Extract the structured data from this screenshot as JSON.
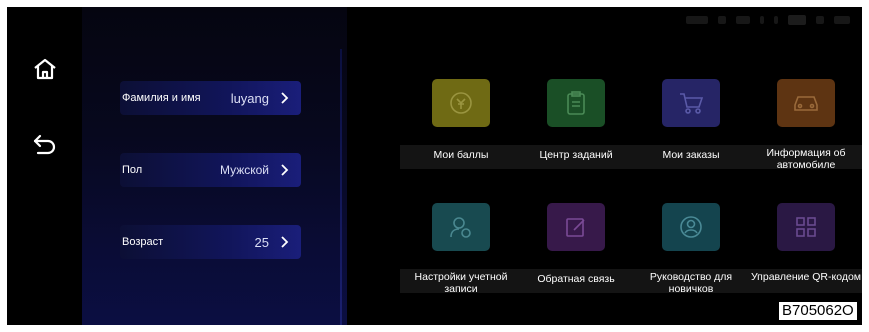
{
  "left_nav": {
    "home_icon": "home-icon",
    "back_icon": "back-arrow-icon"
  },
  "profile": {
    "name": {
      "label": "Фамилия и имя",
      "value": "luyang"
    },
    "gender": {
      "label": "Пол",
      "value": "Мужской"
    },
    "age": {
      "label": "Возраст",
      "value": "25"
    }
  },
  "tiles": [
    {
      "label": "Мои баллы",
      "icon": "points-coin-icon",
      "color": "#7a7a18"
    },
    {
      "label": "Центр заданий",
      "icon": "clipboard-icon",
      "color": "#1d5a2a"
    },
    {
      "label": "Мои заказы",
      "icon": "cart-icon",
      "color": "#2b2a72"
    },
    {
      "label": "Информация об автомобиле",
      "icon": "car-icon",
      "color": "#6a3a14"
    },
    {
      "label": "Настройки учетной записи",
      "icon": "account-settings-icon",
      "color": "#1a5258"
    },
    {
      "label": "Обратная связь",
      "icon": "edit-feedback-icon",
      "color": "#3c1a52"
    },
    {
      "label": "Руководство для новичков",
      "icon": "guide-user-icon",
      "color": "#164a56"
    },
    {
      "label": "Управление QR-кодом",
      "icon": "qr-code-icon",
      "color": "#2e1a4a"
    }
  ],
  "watermark_code": "B705062O"
}
